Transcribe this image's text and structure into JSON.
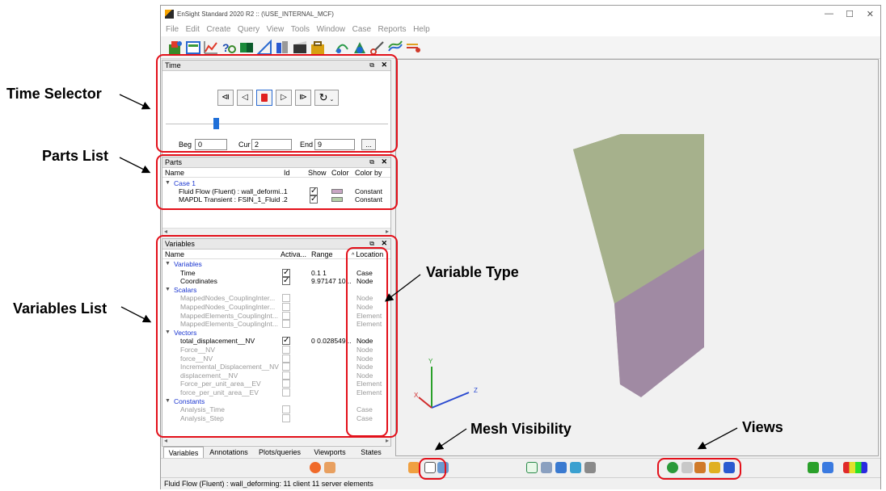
{
  "window": {
    "title": "EnSight Standard 2020 R2 :: (\\USE_INTERNAL_MCF)",
    "minimize": "—",
    "maximize": "☐",
    "close": "✕"
  },
  "menu": [
    "File",
    "Edit",
    "Create",
    "Query",
    "View",
    "Tools",
    "Window",
    "Case",
    "Reports",
    "Help"
  ],
  "time_panel": {
    "title": "Time",
    "beg_label": "Beg",
    "beg_value": "0",
    "cur_label": "Cur",
    "cur_value": "2",
    "end_label": "End",
    "end_value": "9",
    "more_button": "...",
    "slider_fraction": 0.22
  },
  "parts_panel": {
    "title": "Parts",
    "columns": [
      "Name",
      "Id",
      "Show",
      "Color",
      "Color by"
    ],
    "group": "Case 1",
    "rows": [
      {
        "name": "Fluid Flow (Fluent) : wall_deformi...",
        "id": "1",
        "show": true,
        "color": "#c9a6c4",
        "color_by": "Constant"
      },
      {
        "name": "MAPDL Transient : FSIN_1_Fluid ...",
        "id": "2",
        "show": true,
        "color": "#b4cea8",
        "color_by": "Constant"
      }
    ]
  },
  "variables_panel": {
    "title": "Variables",
    "columns": [
      "Name",
      "Activa...",
      "Range",
      "Location"
    ],
    "rows": [
      {
        "kind": "group",
        "name": "Variables"
      },
      {
        "kind": "item",
        "name": "Time",
        "active": true,
        "range": "0.1   1",
        "location": "Case"
      },
      {
        "kind": "item",
        "name": "Coordinates",
        "active": true,
        "range": "9.97147   10...",
        "location": "Node"
      },
      {
        "kind": "group",
        "name": "Scalars"
      },
      {
        "kind": "item",
        "name": "MappedNodes_CouplingInter...",
        "active": false,
        "range": "",
        "location": "Node"
      },
      {
        "kind": "item",
        "name": "MappedNodes_CouplingInter...",
        "active": false,
        "range": "",
        "location": "Node"
      },
      {
        "kind": "item",
        "name": "MappedElements_CouplingInt...",
        "active": false,
        "range": "",
        "location": "Element"
      },
      {
        "kind": "item",
        "name": "MappedElements_CouplingInt...",
        "active": false,
        "range": "",
        "location": "Element"
      },
      {
        "kind": "group",
        "name": "Vectors"
      },
      {
        "kind": "item",
        "name": "total_displacement__NV",
        "active": true,
        "range": "0   0.028549...",
        "location": "Node"
      },
      {
        "kind": "item",
        "name": "Force__NV",
        "active": false,
        "range": "",
        "location": "Node"
      },
      {
        "kind": "item",
        "name": "force__NV",
        "active": false,
        "range": "",
        "location": "Node"
      },
      {
        "kind": "item",
        "name": "Incremental_Displacement__NV",
        "active": false,
        "range": "",
        "location": "Node"
      },
      {
        "kind": "item",
        "name": "displacement__NV",
        "active": false,
        "range": "",
        "location": "Node"
      },
      {
        "kind": "item",
        "name": "Force_per_unit_area__EV",
        "active": false,
        "range": "",
        "location": "Element"
      },
      {
        "kind": "item",
        "name": "force_per_unit_area__EV",
        "active": false,
        "range": "",
        "location": "Element"
      },
      {
        "kind": "group",
        "name": "Constants"
      },
      {
        "kind": "item",
        "name": "Analysis_Time",
        "active": false,
        "range": "",
        "location": "Case"
      },
      {
        "kind": "item",
        "name": "Analysis_Step",
        "active": false,
        "range": "",
        "location": "Case"
      }
    ]
  },
  "tabs": [
    "Variables",
    "Annotations",
    "Plots/queries",
    "Viewports",
    "States"
  ],
  "status": "Fluid Flow (Fluent) : wall_deforming: 11 client 11 server elements",
  "axes": {
    "x": "X",
    "y": "Y",
    "z": "Z"
  },
  "annotations": {
    "time_selector": "Time Selector",
    "parts_list": "Parts List",
    "variables_list": "Variables List",
    "variable_type": "Variable Type",
    "mesh_visibility": "Mesh Visibility",
    "views": "Views"
  },
  "colors": {
    "annotation_red": "#e3101a",
    "part1": "#c9a6c4",
    "part2": "#b4cea8",
    "group_blue": "#1a35d0"
  }
}
